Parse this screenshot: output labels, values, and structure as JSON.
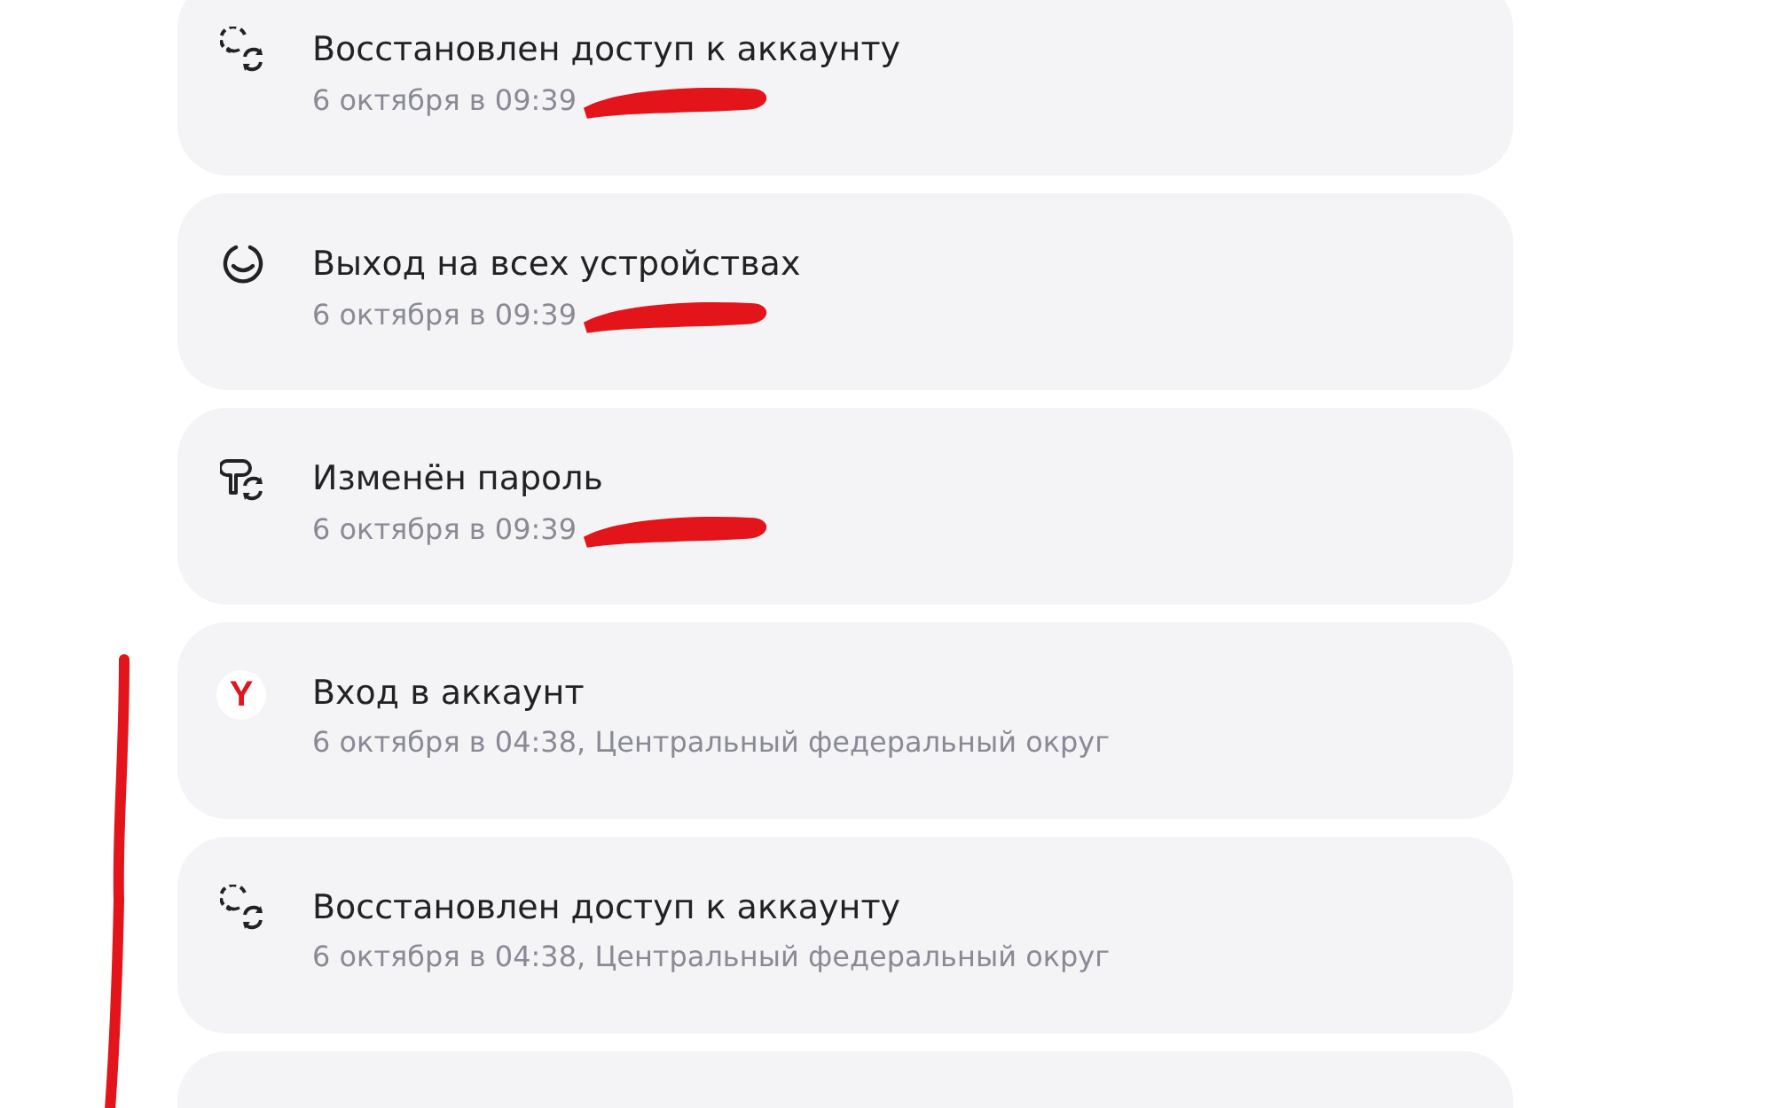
{
  "events": [
    {
      "kind": "restore",
      "title": "Восстановлен доступ к аккаунту",
      "details": "6 октября в 09:39",
      "redacted": true
    },
    {
      "kind": "logout",
      "title": "Выход на всех устройствах",
      "details": "6 октября в 09:39",
      "redacted": true
    },
    {
      "kind": "password",
      "title": "Изменён пароль",
      "details": "6 октября в 09:39",
      "redacted": true
    },
    {
      "kind": "login",
      "logo": "Y",
      "title": "Вход в аккаунт",
      "details": "6 октября в 04:38, Центральный федеральный округ",
      "redacted": false
    },
    {
      "kind": "restore",
      "title": "Восстановлен доступ к аккаунту",
      "details": "6 октября в 04:38, Центральный федеральный округ",
      "redacted": false
    },
    {
      "kind": "partial"
    }
  ],
  "marker_line": true
}
